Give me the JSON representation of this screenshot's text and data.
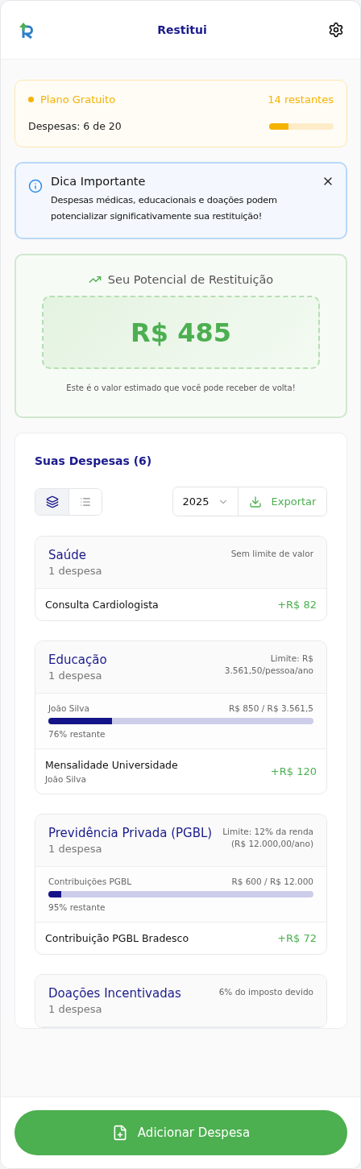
{
  "header": {
    "title": "Restitui"
  },
  "plan": {
    "name": "Plano Gratuito",
    "remaining": "14 restantes",
    "usage": "Despesas: 6 de 20",
    "level": 0.3
  },
  "tip": {
    "title": "Dica Importante",
    "text": "Despesas médicas, educacionais e doações podem potencializar significativamente sua restituição!"
  },
  "potential": {
    "title": "Seu Potencial de Restituição",
    "amount": "R$ 485",
    "caption": "Este é o valor estimado que você pode receber de volta!"
  },
  "expenses": {
    "title": "Suas Despesas (6)",
    "view_toggle": [
      {
        "kind": "grouped",
        "selected": true
      },
      {
        "kind": "list",
        "selected": false
      }
    ],
    "year": "2025",
    "export": "Exportar",
    "groups": [
      {
        "name": "Saúde",
        "count": "1 despesa",
        "limit": "Sem limite de valor",
        "items": [
          {
            "name": "Consulta Cardiologista",
            "amount": "+R$ 82"
          }
        ]
      },
      {
        "name": "Educação",
        "count": "1 despesa",
        "limit": "Limite: R$ 3.561,50/pessoa/ano",
        "progress": {
          "label": "João Silva",
          "values": "R$ 850 / R$ 3.561,5",
          "level": 0.24,
          "remaining": "76% restante"
        },
        "items": [
          {
            "name": "Mensalidade Universidade",
            "person": "João Silva",
            "amount": "+R$ 120"
          }
        ]
      },
      {
        "name": "Previdência Privada (PGBL)",
        "count": "1 despesa",
        "limit": "Limite: 12% da renda (R$ 12.000,00/ano)",
        "progress": {
          "label": "Contribuições PGBL",
          "values": "R$ 600 / R$ 12.000",
          "level": 0.05,
          "remaining": "95% restante"
        },
        "items": [
          {
            "name": "Contribuição PGBL Bradesco",
            "amount": "+R$ 72"
          }
        ]
      },
      {
        "name": "Doações Incentivadas",
        "count": "1 despesa",
        "limit": "6% do imposto devido"
      }
    ]
  },
  "add_button": "Adicionar Despesa"
}
